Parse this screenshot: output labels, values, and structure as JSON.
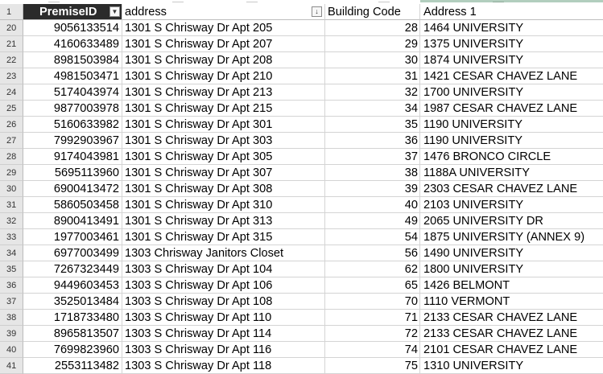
{
  "columns": {
    "premise_id": "PremiseID",
    "address": "address",
    "building_code": "Building Code",
    "address1": "Address 1"
  },
  "header_row_number": "1",
  "filter_icons": [
    "filter-dropdown-icon",
    "filter-sorted-icon"
  ],
  "rows": [
    {
      "n": "20",
      "premise_id": "9056133514",
      "address": "1301 S Chrisway Dr Apt 205",
      "building_code": "28",
      "address1": "1464 UNIVERSITY"
    },
    {
      "n": "21",
      "premise_id": "4160633489",
      "address": "1301 S Chrisway Dr Apt 207",
      "building_code": "29",
      "address1": "1375 UNIVERSITY"
    },
    {
      "n": "22",
      "premise_id": "8981503984",
      "address": "1301 S Chrisway Dr Apt 208",
      "building_code": "30",
      "address1": "1874 UNIVERSITY"
    },
    {
      "n": "23",
      "premise_id": "4981503471",
      "address": "1301 S Chrisway Dr Apt 210",
      "building_code": "31",
      "address1": "1421 CESAR CHAVEZ LANE"
    },
    {
      "n": "24",
      "premise_id": "5174043974",
      "address": "1301 S Chrisway Dr Apt 213",
      "building_code": "32",
      "address1": "1700 UNIVERSITY"
    },
    {
      "n": "25",
      "premise_id": "9877003978",
      "address": "1301 S Chrisway Dr Apt 215",
      "building_code": "34",
      "address1": "1987 CESAR CHAVEZ LANE"
    },
    {
      "n": "26",
      "premise_id": "5160633982",
      "address": "1301 S Chrisway Dr Apt 301",
      "building_code": "35",
      "address1": "1190 UNIVERSITY"
    },
    {
      "n": "27",
      "premise_id": "7992903967",
      "address": "1301 S Chrisway Dr Apt 303",
      "building_code": "36",
      "address1": "1190 UNIVERSITY"
    },
    {
      "n": "28",
      "premise_id": "9174043981",
      "address": "1301 S Chrisway Dr Apt 305",
      "building_code": "37",
      "address1": "1476 BRONCO CIRCLE"
    },
    {
      "n": "29",
      "premise_id": "5695113960",
      "address": "1301 S Chrisway Dr Apt 307",
      "building_code": "38",
      "address1": "1188A UNIVERSITY"
    },
    {
      "n": "30",
      "premise_id": "6900413472",
      "address": "1301 S Chrisway Dr Apt 308",
      "building_code": "39",
      "address1": "2303 CESAR CHAVEZ LANE"
    },
    {
      "n": "31",
      "premise_id": "5860503458",
      "address": "1301 S Chrisway Dr Apt 310",
      "building_code": "40",
      "address1": "2103 UNIVERSITY"
    },
    {
      "n": "32",
      "premise_id": "8900413491",
      "address": "1301 S Chrisway Dr Apt 313",
      "building_code": "49",
      "address1": "2065 UNIVERSITY DR"
    },
    {
      "n": "33",
      "premise_id": "1977003461",
      "address": "1301 S Chrisway Dr Apt 315",
      "building_code": "54",
      "address1": "1875 UNIVERSITY (ANNEX 9)"
    },
    {
      "n": "34",
      "premise_id": "6977003499",
      "address": "1303 Chrisway Janitors Closet",
      "building_code": "56",
      "address1": "1490 UNIVERSITY"
    },
    {
      "n": "35",
      "premise_id": "7267323449",
      "address": "1303 S Chrisway Dr Apt 104",
      "building_code": "62",
      "address1": "1800 UNIVERSITY"
    },
    {
      "n": "36",
      "premise_id": "9449603453",
      "address": "1303 S Chrisway Dr Apt 106",
      "building_code": "65",
      "address1": "1426 BELMONT"
    },
    {
      "n": "37",
      "premise_id": "3525013484",
      "address": "1303 S Chrisway Dr Apt 108",
      "building_code": "70",
      "address1": "1110 VERMONT"
    },
    {
      "n": "38",
      "premise_id": "1718733480",
      "address": "1303 S Chrisway Dr Apt 110",
      "building_code": "71",
      "address1": "2133 CESAR CHAVEZ LANE"
    },
    {
      "n": "39",
      "premise_id": "8965813507",
      "address": "1303 S Chrisway Dr Apt 114",
      "building_code": "72",
      "address1": "2133 CESAR CHAVEZ LANE"
    },
    {
      "n": "40",
      "premise_id": "7699823960",
      "address": "1303 S Chrisway Dr Apt 116",
      "building_code": "74",
      "address1": "2101 CESAR CHAVEZ LANE"
    },
    {
      "n": "41",
      "premise_id": "2553113482",
      "address": "1303 S Chrisway Dr Apt 118",
      "building_code": "75",
      "address1": "1310 UNIVERSITY"
    }
  ]
}
